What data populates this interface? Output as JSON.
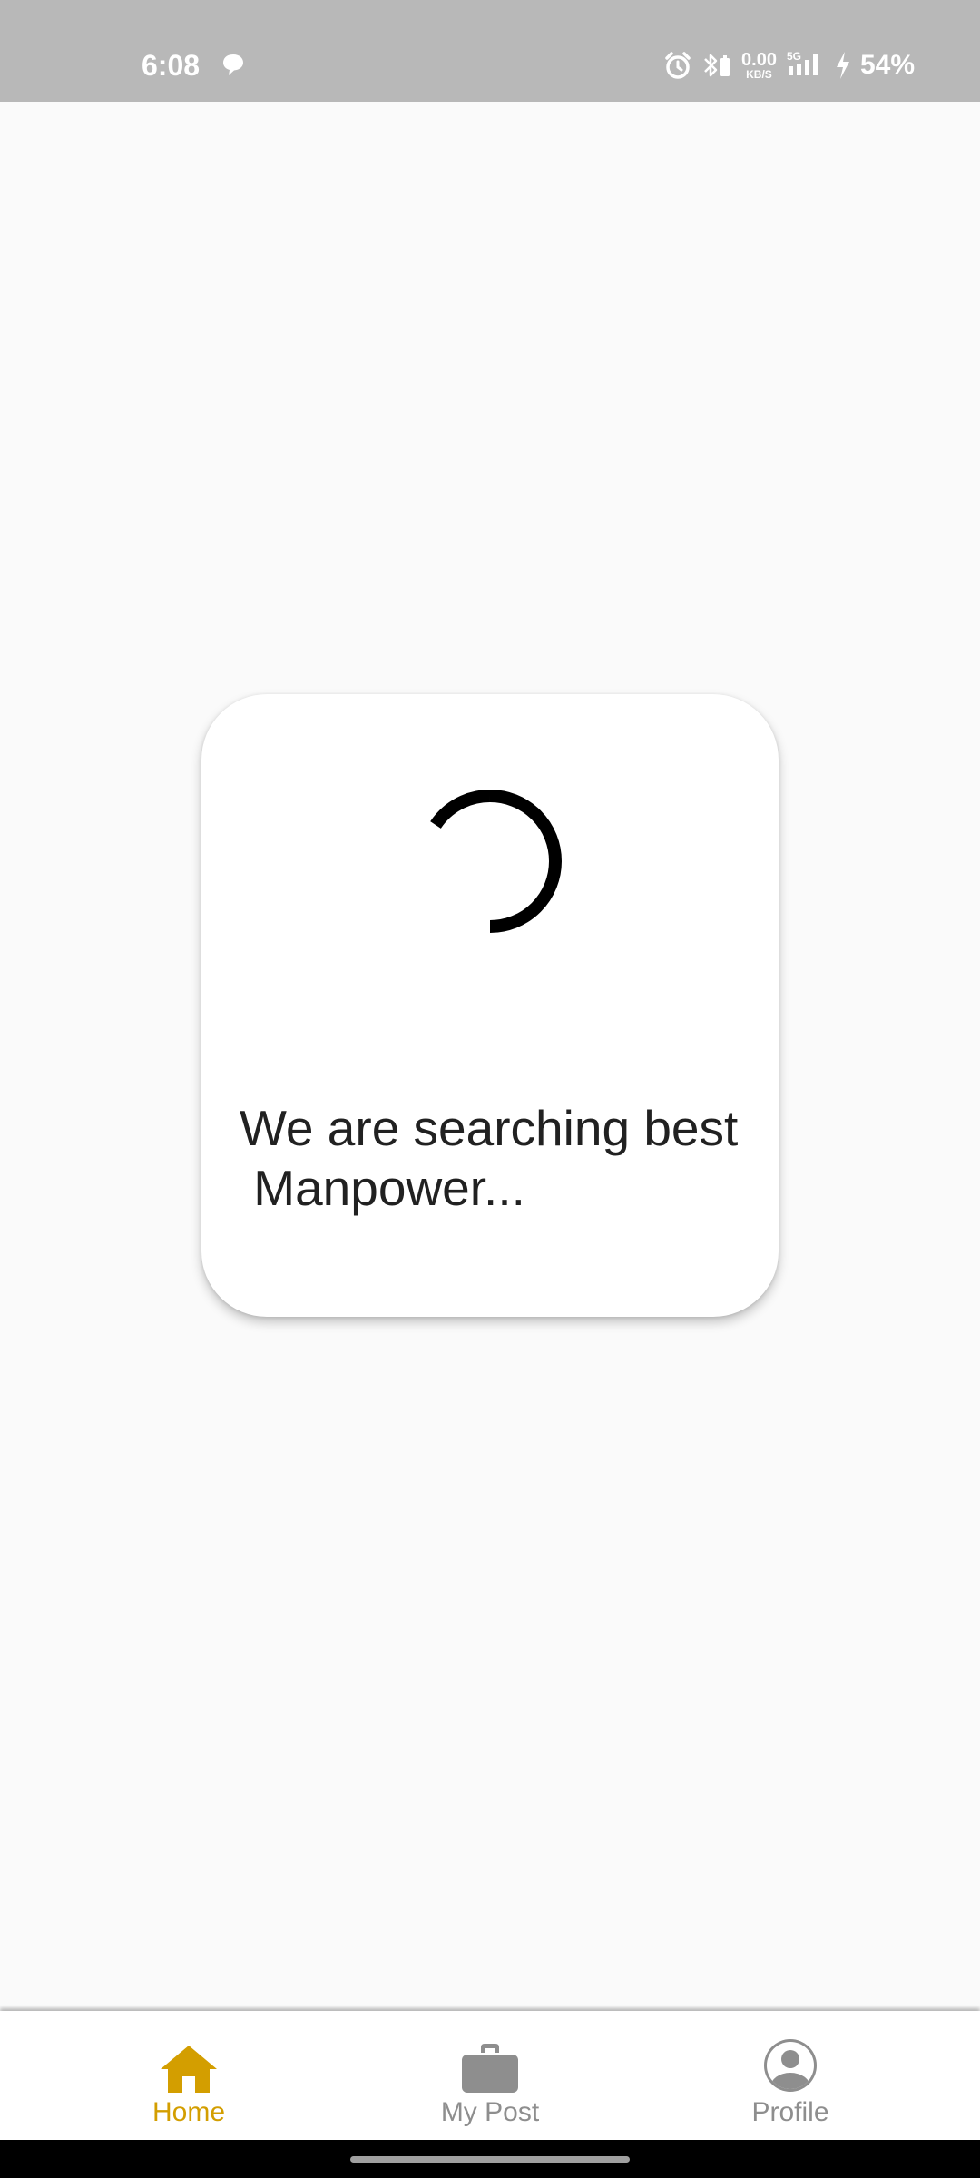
{
  "status_bar": {
    "time": "6:08",
    "net_speed_value": "0.00",
    "net_speed_unit": "KB/S",
    "signal_label": "5G",
    "battery": "54%"
  },
  "loading_dialog": {
    "message": "We are searching best\n Manpower..."
  },
  "bottom_nav": {
    "active_color": "#d39e00",
    "inactive_color": "#8e8e8e",
    "items": [
      {
        "label": "Home",
        "icon": "home-icon",
        "active": true
      },
      {
        "label": "My Post",
        "icon": "briefcase-icon",
        "active": false
      },
      {
        "label": "Profile",
        "icon": "account-circle-icon",
        "active": false
      }
    ]
  }
}
